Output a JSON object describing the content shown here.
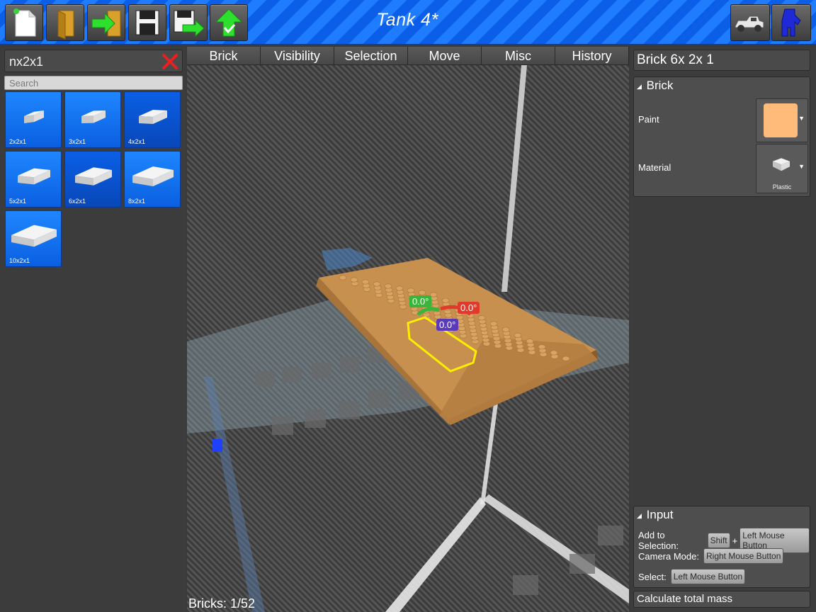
{
  "toolbar": {
    "buttons": [
      {
        "name": "new-file-icon"
      },
      {
        "name": "open-folder-icon"
      },
      {
        "name": "import-icon"
      },
      {
        "name": "save-icon"
      },
      {
        "name": "save-as-icon"
      },
      {
        "name": "upload-icon"
      }
    ],
    "title": "Tank 4*",
    "right_buttons": [
      {
        "name": "vehicle-mode-icon"
      },
      {
        "name": "minifig-icon"
      }
    ]
  },
  "left_panel": {
    "filter_value": "nx2x1",
    "search_placeholder": "Search",
    "bricks": [
      {
        "label": "2x2x1",
        "selected": false
      },
      {
        "label": "3x2x1",
        "selected": false
      },
      {
        "label": "4x2x1",
        "selected": true
      },
      {
        "label": "5x2x1",
        "selected": false
      },
      {
        "label": "6x2x1",
        "selected": true
      },
      {
        "label": "8x2x1",
        "selected": false
      },
      {
        "label": "10x2x1",
        "selected": false
      }
    ]
  },
  "tabs": [
    "Brick",
    "Visibility",
    "Selection",
    "Move",
    "Misc",
    "History"
  ],
  "viewport": {
    "gizmo": {
      "green_angle": "0.0°",
      "red_angle": "0.0°",
      "blue_angle": "0.0°"
    },
    "status": "Bricks: 1/52"
  },
  "right_panel": {
    "brick_name": "Brick 6x 2x 1",
    "brick_section": {
      "title": "Brick",
      "paint_label": "Paint",
      "paint_color": "#ffbb7a",
      "material_label": "Material",
      "material_value": "Plastic"
    },
    "input_section": {
      "title": "Input",
      "rows": [
        {
          "label": "Add to Selection:",
          "keys": [
            "Shift",
            "Left Mouse Button"
          ],
          "joiner": "+"
        },
        {
          "label": "Camera Mode:",
          "keys": [
            "Right Mouse Button"
          ]
        },
        {
          "label": "Select:",
          "keys": [
            "Left Mouse Button"
          ]
        }
      ]
    },
    "calculate_mass_label": "Calculate total mass"
  },
  "colors": {
    "accent_blue": "#1f7cff",
    "brick_tan": "#c8904e",
    "selection_outline": "#ffee00",
    "gizmo_green": "#3bb43b",
    "gizmo_red": "#e03a2a",
    "gizmo_blue": "#5a3ab8"
  }
}
